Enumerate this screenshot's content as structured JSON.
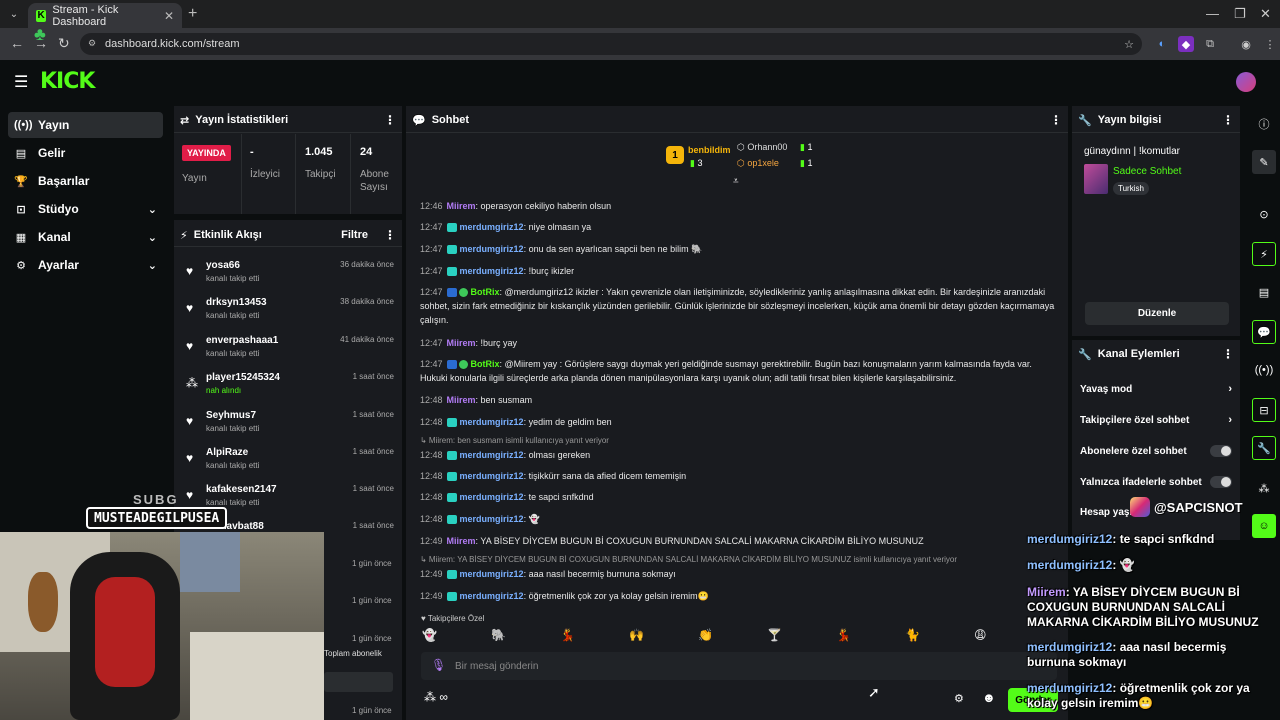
{
  "browser": {
    "tab_title": "Stream - Kick Dashboard",
    "url": "dashboard.kick.com/stream"
  },
  "sidebar": {
    "items": [
      {
        "label": "Yayın"
      },
      {
        "label": "Gelir"
      },
      {
        "label": "Başarılar"
      },
      {
        "label": "Stüdyo"
      },
      {
        "label": "Kanal"
      },
      {
        "label": "Ayarlar"
      }
    ]
  },
  "stats": {
    "title": "Yayın İstatistikleri",
    "live_badge": "YAYINDA",
    "live_label": "Yayın",
    "viewers_value": "-",
    "viewers_label": "İzleyici",
    "followers_value": "1.045",
    "followers_label": "Takipçi",
    "subs_value": "24",
    "subs_label": "Abone Sayısı"
  },
  "activity": {
    "title": "Etkinlik Akışı",
    "filter": "Filtre",
    "items": [
      {
        "name": "yosa66",
        "action": "kanalı takip etti",
        "time": "36 dakika önce"
      },
      {
        "name": "drksyn13453",
        "action": "kanalı takip etti",
        "time": "38 dakika önce"
      },
      {
        "name": "enverpashaaa1",
        "action": "kanalı takip etti",
        "time": "41 dakika önce"
      },
      {
        "name": "player15245324",
        "action": "nah alındı",
        "time": "1 saat önce"
      },
      {
        "name": "Seyhmus7",
        "action": "kanalı takip etti",
        "time": "1 saat önce"
      },
      {
        "name": "AlpiRaze",
        "action": "kanalı takip etti",
        "time": "1 saat önce"
      },
      {
        "name": "kafakesen2147",
        "action": "kanalı takip etti",
        "time": "1 saat önce"
      },
      {
        "name": "manavbat88",
        "action": "",
        "time": "1 saat önce"
      }
    ],
    "extra_times": [
      "1 gün önce",
      "1 gün önce",
      "1 gün önce",
      "1 gün önce"
    ],
    "footer": "Toplam abonelik"
  },
  "chat": {
    "title": "Sohbet",
    "leaders": {
      "rank": "1",
      "top_name": "benbildim",
      "top_count": "3",
      "second_name": "Orhann00",
      "second_count": "1",
      "third_name": "op1xele",
      "third_count": "1"
    },
    "messages": [
      {
        "time": "12:46",
        "user": "Miirem",
        "type": "mir",
        "text": ": operasyon cekiliyo haberin olsun"
      },
      {
        "time": "12:47",
        "user": "merdumgiriz12",
        "type": "mer",
        "text": ": niye olmasın ya"
      },
      {
        "time": "12:47",
        "user": "merdumgiriz12",
        "type": "mer",
        "text": ": onu da sen ayarlıcan sapcii ben ne bilim 🐘"
      },
      {
        "time": "12:47",
        "user": "merdumgiriz12",
        "type": "mer",
        "text": ": !burç ikizler"
      },
      {
        "time": "12:47",
        "user": "BotRix",
        "type": "bot",
        "text": ": @merdumgiriz12 ikizler : Yakın çevrenizle olan iletişiminizde, söyledikleriniz yanlış anlaşılmasına dikkat edin. Bir kardeşinizle aranızdaki sohbet, sizin fark etmediğiniz bir kıskançlık yüzünden gerilebilir. Günlük işlerinizde bir sözleşmeyi incelerken, küçük ama önemli bir detayı gözden kaçırmamaya çalışın."
      },
      {
        "time": "12:47",
        "user": "Miirem",
        "type": "mir",
        "text": ": !burç yay"
      },
      {
        "time": "12:47",
        "user": "BotRix",
        "type": "bot",
        "text": ": @Miirem yay : Görüşlere saygı duymak yeri geldiğinde susmayı gerektirebilir. Bugün bazı konuşmaların yarım kalmasında fayda var. Hukuki konularla ilgili süreçlerde arka planda dönen manipülasyonlara karşı uyanık olun; adil tatili fırsat bilen kişilerle karşılaşabilirsiniz."
      },
      {
        "time": "12:48",
        "user": "Miirem",
        "type": "mir",
        "text": ": ben susmam"
      },
      {
        "time": "12:48",
        "user": "merdumgiriz12",
        "type": "mer",
        "text": ": yedim de geldim ben"
      },
      {
        "time": "12:48",
        "user": "merdumgiriz12",
        "type": "mer",
        "text": ": olması gereken"
      },
      {
        "time": "12:48",
        "user": "merdumgiriz12",
        "type": "mer",
        "text": ": tişikkürr sana da afied dicem tememişin"
      },
      {
        "time": "12:48",
        "user": "merdumgiriz12",
        "type": "mer",
        "text": ": te sapci snfkdnd"
      },
      {
        "time": "12:48",
        "user": "merdumgiriz12",
        "type": "mer",
        "text": ": 👻"
      },
      {
        "time": "12:49",
        "user": "Miirem",
        "type": "mir",
        "text": ": YA BİSEY DİYCEM BUGUN Bİ COXUGUN BURNUNDAN SALCALİ MAKARNA CİKARDİM BİLİYO MUSUNUZ"
      },
      {
        "time": "12:49",
        "user": "merdumgiriz12",
        "type": "mer",
        "text": ": aaa nasıl becermiş burnuna sokmayı"
      },
      {
        "time": "12:49",
        "user": "merdumgiriz12",
        "type": "mer",
        "text": ": öğretmenlik çok zor ya kolay gelsin iremim😬"
      }
    ],
    "reply1": "↳ Miirem: ben susmam isimli kullanıcıya yanıt veriyor",
    "reply2": "↳ Miirem: YA BİSEY DİYCEM BUGUN Bİ COXUGUN BURNUNDAN SALCALİ MAKARNA CİKARDİM BİLİYO MUSUNUZ isimli kullanıcıya yanıt veriyor",
    "followers_only": "♥ Takipçilere Özel",
    "emotes": [
      "👻",
      "🐘",
      "💃",
      "🙌",
      "👏",
      "🍸",
      "💃",
      "🐈",
      "😩"
    ],
    "placeholder": "Bir mesaj gönderin",
    "send": "Gönder"
  },
  "stream_info": {
    "title": "Yayın bilgisi",
    "stream_title": "günaydınn | !komutlar",
    "category": "Sadece Sohbet",
    "language": "Turkish",
    "edit": "Düzenle"
  },
  "channel_actions": {
    "title": "Kanal Eylemleri",
    "items": [
      {
        "label": "Yavaş mod",
        "kind": "chevron"
      },
      {
        "label": "Takipçilere özel sohbet",
        "kind": "chevron"
      },
      {
        "label": "Abonelere özel sohbet",
        "kind": "toggle"
      },
      {
        "label": "Yalnızca ifadelerle sohbet",
        "kind": "toggle"
      },
      {
        "label": "Hesap yaşı",
        "kind": "chevron"
      }
    ]
  },
  "overlay": {
    "sub_label": "SUBG",
    "sub_name": "MUSTEADEGILPUSEA",
    "social": "@SAPCISNOT",
    "lines": [
      {
        "user": "merdumgiriz12",
        "type": "mer",
        "text": ": te sapci snfkdnd"
      },
      {
        "user": "merdumgiriz12",
        "type": "mer",
        "text": ": 👻"
      },
      {
        "user": "Miirem",
        "type": "mir",
        "text": ": YA BİSEY DİYCEM BUGUN Bİ COXUGUN BURNUNDAN SALCALİ MAKARNA CİKARDİM BİLİYO MUSUNUZ"
      },
      {
        "user": "merdumgiriz12",
        "type": "mer",
        "text": ": aaa nasıl becermiş burnuna sokmayı"
      },
      {
        "user": "merdumgiriz12",
        "type": "mer",
        "text": ": öğretmenlik çok zor ya kolay gelsin iremim😬"
      }
    ]
  },
  "colors": {
    "kick_green": "#53fc18",
    "live_red": "#e11d48",
    "panel_bg": "#191b1f"
  }
}
